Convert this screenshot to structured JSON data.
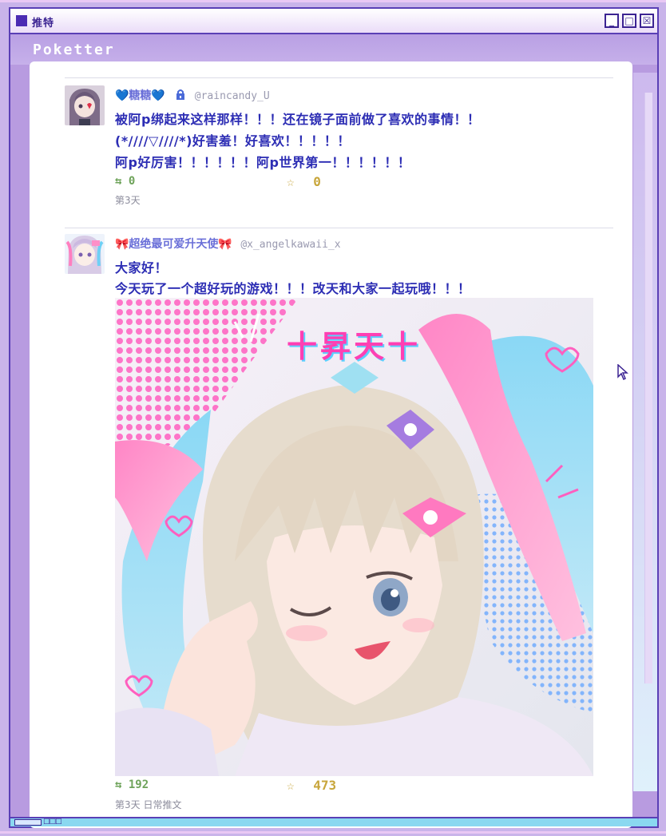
{
  "window": {
    "title": "推特"
  },
  "window_buttons": {
    "minimize": "_",
    "maximize": "□",
    "close": "☒"
  },
  "app": {
    "name": "Poketter"
  },
  "posts": [
    {
      "display_name": "💙糖糖💙",
      "handle": "@raincandy_U",
      "lines": [
        "被阿p绑起来这样那样！！！还在镜子面前做了喜欢的事情！！",
        "(*////▽////*)好害羞！好喜欢！！！！！",
        "阿p好厉害！！！！！！阿p世界第一！！！！！！"
      ],
      "retweet_icon": "⇆",
      "retweets": "0",
      "fav_icon": "☆",
      "likes": "0",
      "timestamp": "第3天"
    },
    {
      "display_name": "🎀超绝最可爱升天使🎀",
      "handle": "@x_angelkawaii_x",
      "lines": [
        "大家好！",
        "今天玩了一个超好玩的游戏！！！改天和大家一起玩哦！！！"
      ],
      "image_text": "十昇天十",
      "retweet_icon": "⇆",
      "retweets": "192",
      "fav_icon": "☆",
      "likes": "473",
      "timestamp": "第3天 日常推文"
    }
  ],
  "taskbar": {
    "dots": "□□□"
  },
  "colors": {
    "accent": "#5a3fb6",
    "name_blue": "#6a6fd8",
    "body_text": "#2c2db4",
    "retweet_green": "#6ea35a",
    "like_gold": "#c8a63c"
  }
}
